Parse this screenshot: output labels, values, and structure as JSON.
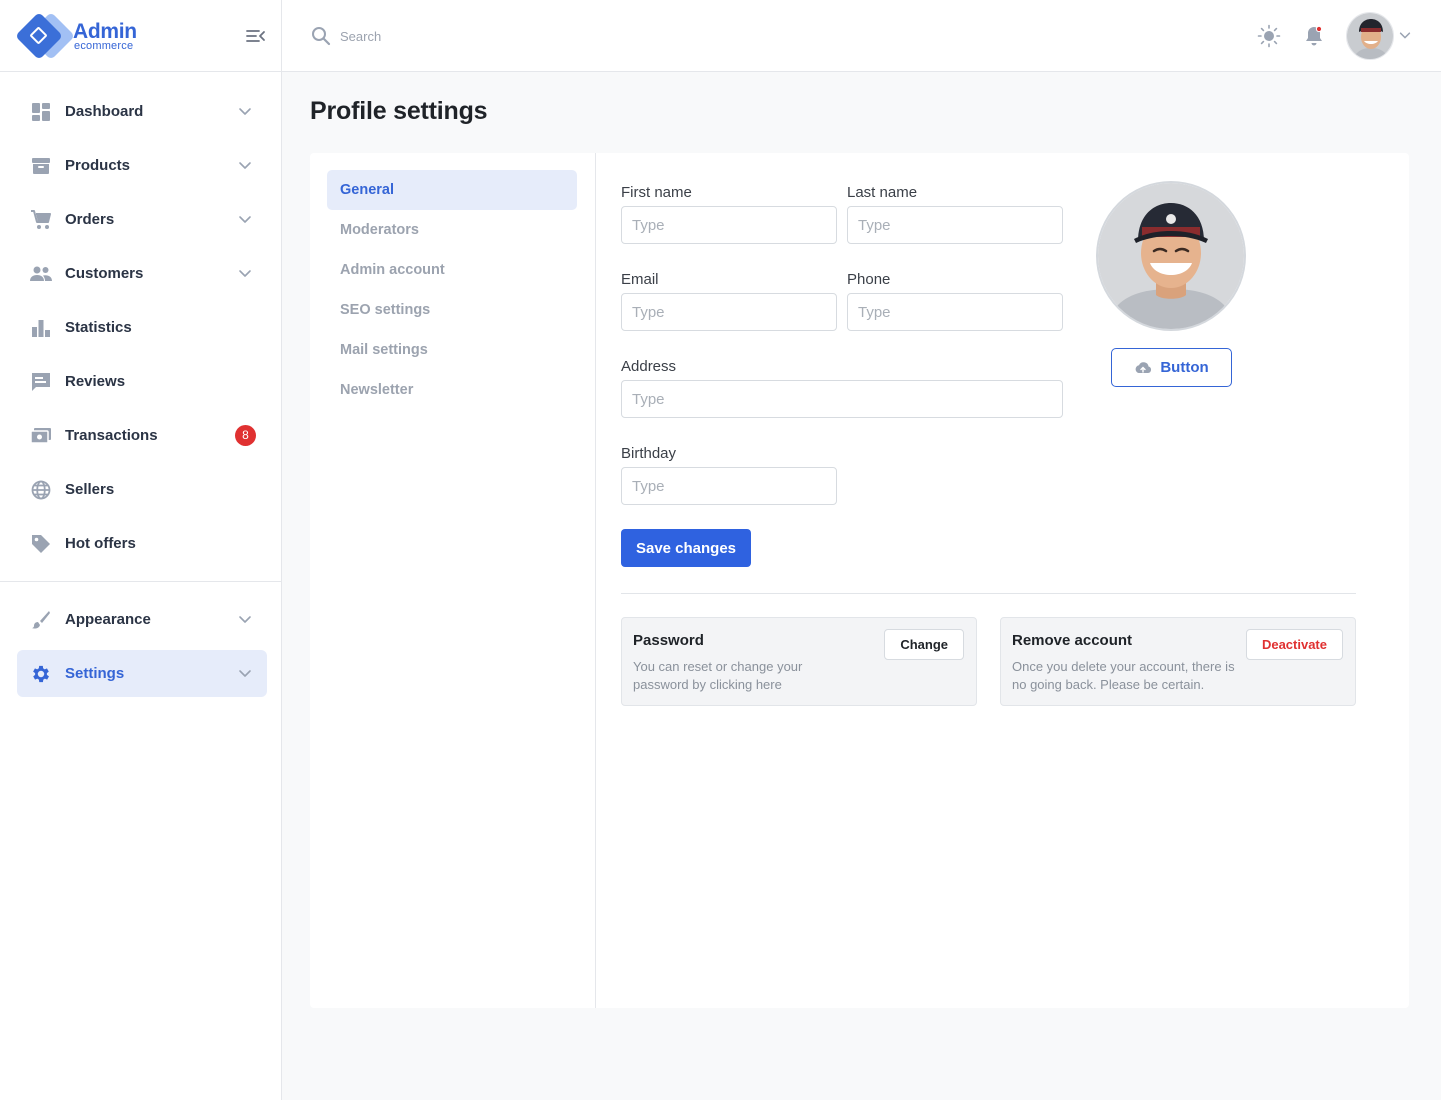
{
  "brand": {
    "title": "Admin",
    "subtitle": "ecommerce"
  },
  "sidebar": {
    "items": [
      {
        "label": "Dashboard",
        "icon": "dashboard-icon",
        "has_chevron": true
      },
      {
        "label": "Products",
        "icon": "archive-box-icon",
        "has_chevron": true
      },
      {
        "label": "Orders",
        "icon": "cart-icon",
        "has_chevron": true
      },
      {
        "label": "Customers",
        "icon": "people-icon",
        "has_chevron": true
      },
      {
        "label": "Statistics",
        "icon": "bar-chart-icon",
        "has_chevron": false
      },
      {
        "label": "Reviews",
        "icon": "comment-icon",
        "has_chevron": false
      },
      {
        "label": "Transactions",
        "icon": "money-icon",
        "badge": "8"
      },
      {
        "label": "Sellers",
        "icon": "globe-icon",
        "has_chevron": false
      },
      {
        "label": "Hot offers",
        "icon": "tag-icon",
        "has_chevron": false
      }
    ],
    "bottom_items": [
      {
        "label": "Appearance",
        "icon": "brush-icon",
        "has_chevron": true
      },
      {
        "label": "Settings",
        "icon": "gear-icon",
        "has_chevron": true,
        "active": true
      }
    ]
  },
  "header": {
    "search": {
      "placeholder": "Search",
      "value": ""
    }
  },
  "page": {
    "title": "Profile settings"
  },
  "settings_nav": {
    "items": [
      "General",
      "Moderators",
      "Admin account",
      "SEO settings",
      "Mail settings",
      "Newsletter"
    ],
    "active": "General"
  },
  "form": {
    "first_name": {
      "label": "First name",
      "placeholder": "Type",
      "value": ""
    },
    "last_name": {
      "label": "Last name",
      "placeholder": "Type",
      "value": ""
    },
    "email": {
      "label": "Email",
      "placeholder": "Type",
      "value": ""
    },
    "phone": {
      "label": "Phone",
      "placeholder": "Type",
      "value": ""
    },
    "address": {
      "label": "Address",
      "placeholder": "Type",
      "value": ""
    },
    "birthday": {
      "label": "Birthday",
      "placeholder": "Type",
      "value": ""
    },
    "upload_label": "Button",
    "save_label": "Save changes"
  },
  "password_box": {
    "title": "Password",
    "text": "You can reset or change your password by clicking here",
    "button": "Change"
  },
  "remove_box": {
    "title": "Remove account",
    "text": "Once you delete your account, there is no going back. Please be certain.",
    "button": "Deactivate"
  },
  "colors": {
    "accent": "#3565d6",
    "primary_button": "#2f62e0",
    "danger": "#e03131",
    "active_bg": "#e6ecfa"
  }
}
